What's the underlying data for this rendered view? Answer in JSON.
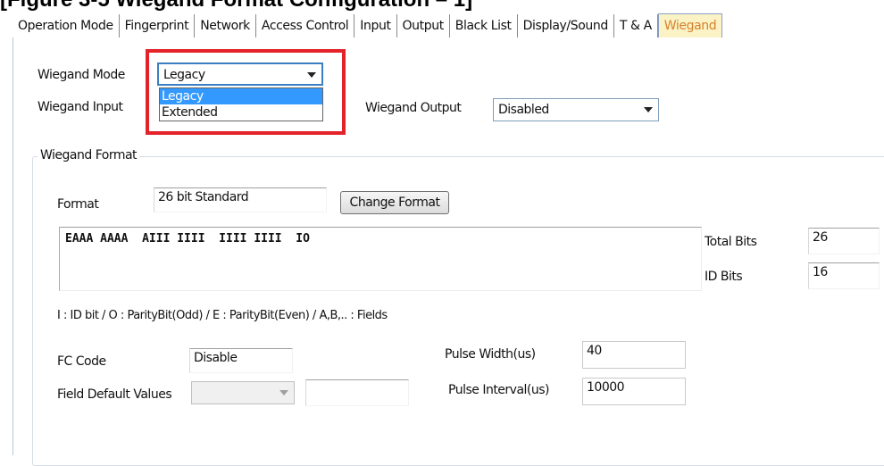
{
  "page_title": "[Figure 3-5 Wiegand Format Configuration – 1]",
  "tabs": [
    {
      "label": "Operation Mode",
      "active": false
    },
    {
      "label": "Fingerprint",
      "active": false
    },
    {
      "label": "Network",
      "active": false
    },
    {
      "label": "Access Control",
      "active": false
    },
    {
      "label": "Input",
      "active": false
    },
    {
      "label": "Output",
      "active": false
    },
    {
      "label": "Black List",
      "active": false
    },
    {
      "label": "Display/Sound",
      "active": false
    },
    {
      "label": "T & A",
      "active": false
    },
    {
      "label": "Wiegand",
      "active": true
    }
  ],
  "wiegand_mode": {
    "label": "Wiegand Mode",
    "selected": "Legacy",
    "options": [
      "Legacy",
      "Extended"
    ]
  },
  "wiegand_input": {
    "label": "Wiegand Input"
  },
  "wiegand_output": {
    "label": "Wiegand Output",
    "selected": "Disabled"
  },
  "wiegand_format": {
    "group_title": "Wiegand Format",
    "format_label": "Format",
    "format_value": "26 bit Standard",
    "change_format_label": "Change Format",
    "bit_pattern": "EAAA AAAA  AIII IIII  IIII IIII  IO",
    "total_bits_label": "Total Bits",
    "total_bits_value": "26",
    "id_bits_label": "ID Bits",
    "id_bits_value": "16",
    "legend": "I : ID bit  /  O : ParityBit(Odd)  /  E : ParityBit(Even)  /  A,B,.. : Fields",
    "fc_code_label": "FC Code",
    "fc_code_value": "Disable",
    "field_default_label": "Field Default Values",
    "field_default_selected": "",
    "field_default_value": "",
    "pulse_width_label": "Pulse Width(us)",
    "pulse_width_value": "40",
    "pulse_interval_label": "Pulse Interval(us)",
    "pulse_interval_value": "10000"
  },
  "colors": {
    "active_tab_bg": "#fbf3c5",
    "active_tab_text": "#d6812b",
    "highlight_box": "#e3222a",
    "selection": "#3399ff"
  }
}
